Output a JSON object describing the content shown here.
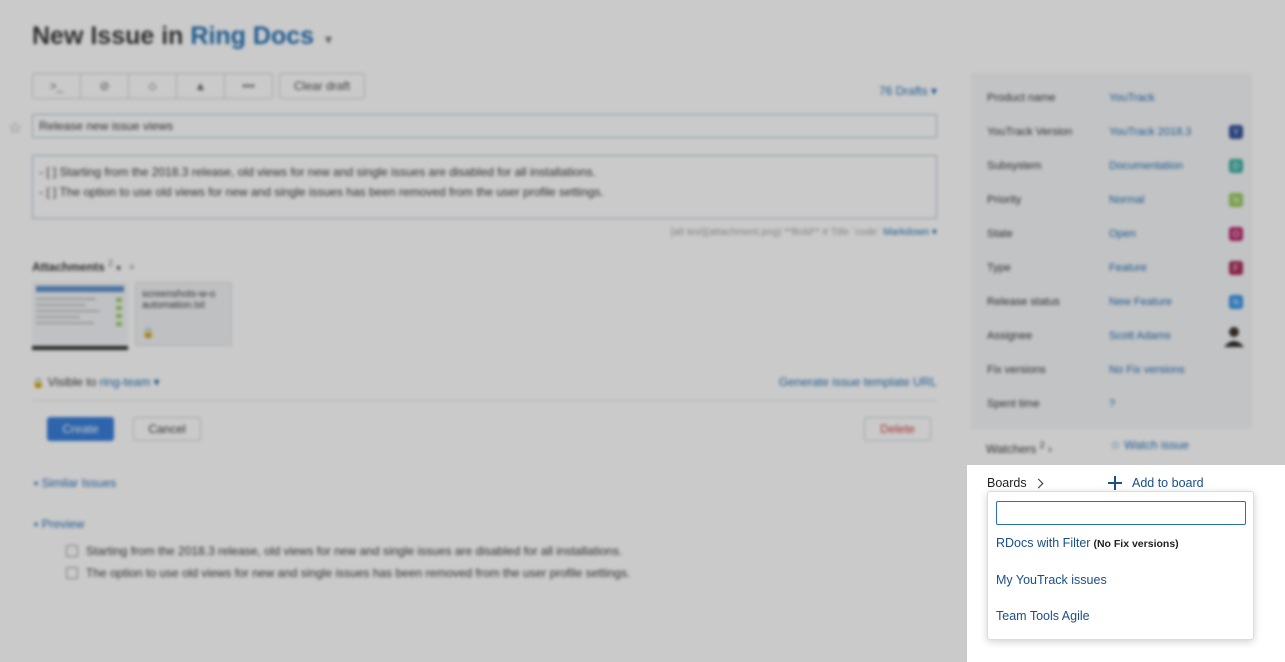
{
  "header": {
    "title_prefix": "New Issue in",
    "project": "Ring Docs",
    "caret": "▾"
  },
  "toolbar": {
    "icons": [
      "command-icon",
      "link-icon",
      "tag-icon",
      "user-icon",
      "more-icon"
    ],
    "icon_glyphs": [
      ">_",
      "⊘",
      "⬦",
      "▲",
      "•••"
    ],
    "clear_draft_label": "Clear draft",
    "drafts_label": "76 Drafts ▾"
  },
  "editor": {
    "summary_value": "Release new issue views",
    "description_lines": [
      "- [ ] Starting from the 2018.3 release, old views for new and single issues are disabled for all installations.",
      "- [ ] The option to use old views for new and single issues has been removed from the user profile settings."
    ],
    "markdown_hint": "[alt text](attachment.png) **Bold** # Title `code`",
    "markdown_link": "Markdown ▾"
  },
  "attachments": {
    "label": "Attachments",
    "count": "2",
    "file2_name": "screenshots-w-o automation.txt"
  },
  "visibility": {
    "prefix": "Visible to",
    "group": "ring-team ▾",
    "generate_url": "Generate issue template URL"
  },
  "actions": {
    "create": "Create",
    "cancel": "Cancel",
    "delete": "Delete"
  },
  "sections": {
    "similar": "Similar Issues",
    "preview": "Preview",
    "preview_items": [
      "Starting from the 2018.3 release, old views for new and single issues are disabled for all installations.",
      "The option to use old views for new and single issues has been removed from the user profile settings."
    ]
  },
  "fields": [
    {
      "name": "Product name",
      "value": "YouTrack",
      "color": ""
    },
    {
      "name": "YouTrack Version",
      "value": "YouTrack 2018.3",
      "color": "#1a3d8f",
      "badge": "Y"
    },
    {
      "name": "Subsystem",
      "value": "Documentation",
      "color": "#26a69a",
      "badge": "D"
    },
    {
      "name": "Priority",
      "value": "Normal",
      "color": "#8bc34a",
      "badge": "N"
    },
    {
      "name": "State",
      "value": "Open",
      "color": "#b0125e",
      "badge": "O"
    },
    {
      "name": "Type",
      "value": "Feature",
      "color": "#a0124a",
      "badge": "F"
    },
    {
      "name": "Release status",
      "value": "New Feature",
      "color": "#1e88e5",
      "badge": "N"
    },
    {
      "name": "Assignee",
      "value": "Scott Adams",
      "color": ""
    },
    {
      "name": "Fix versions",
      "value": "No Fix versions",
      "color": ""
    },
    {
      "name": "Spent time",
      "value": "?",
      "color": ""
    }
  ],
  "watchers": {
    "label": "Watchers",
    "count": "2",
    "watch_link": "Watch issue"
  },
  "boards": {
    "label": "Boards",
    "add_label": "Add to board",
    "search_value": "",
    "options": [
      {
        "label": "RDocs with Filter",
        "hint": "(No Fix versions)"
      },
      {
        "label": "My YouTrack issues",
        "hint": ""
      },
      {
        "label": "Team Tools Agile",
        "hint": ""
      }
    ]
  }
}
